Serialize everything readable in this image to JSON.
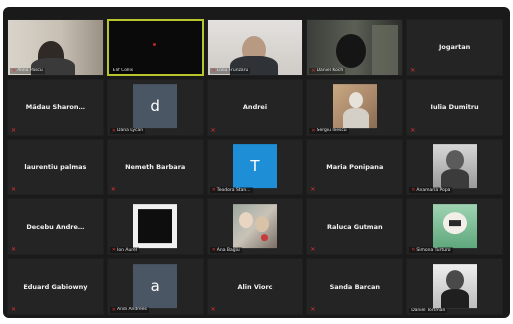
{
  "row1": {
    "t1": {
      "label": "Alina Pascu"
    },
    "t2": {
      "label": "Elif Collis"
    },
    "t3": {
      "label": "Liviu Frunzaru"
    },
    "t4": {
      "label": "Daniel Koch"
    },
    "t5": {
      "name": "Jogartan"
    }
  },
  "row2": {
    "t1": {
      "name": "Mădau Sharon…"
    },
    "t2": {
      "avatar_letter": "d",
      "avatar_color": "#4a5663",
      "label": "Dana Lycan"
    },
    "t3": {
      "name": "Andrei"
    },
    "t4": {
      "label": "Sergiu Iliescu"
    },
    "t5": {
      "name": "Iulia Dumitru"
    }
  },
  "row3": {
    "t1": {
      "name": "laurentiu palmas"
    },
    "t2": {
      "name": "Nemeth Barbara"
    },
    "t3": {
      "avatar_letter": "T",
      "avatar_color": "#1e8fd6",
      "label": "Teodora Stan…"
    },
    "t4": {
      "name": "Maria Ponipana"
    },
    "t5": {
      "label": "Anamaria Popa"
    }
  },
  "row4": {
    "t1": {
      "name": "Decebu Andre…"
    },
    "t2": {
      "label": "Ion Aurel"
    },
    "t3": {
      "label": "Ana Bagiu"
    },
    "t4": {
      "name": "Raluca Gutman"
    },
    "t5": {
      "label": "Simona Turturo"
    }
  },
  "row5": {
    "t1": {
      "name": "Eduard Gabiowny"
    },
    "t2": {
      "avatar_letter": "a",
      "avatar_color": "#4a5663",
      "label": "Andi Andrees"
    },
    "t3": {
      "name": "Alin Viorc"
    },
    "t4": {
      "name": "Sanda Barcan"
    },
    "t5": {
      "label": "Daniel Tortman"
    }
  }
}
